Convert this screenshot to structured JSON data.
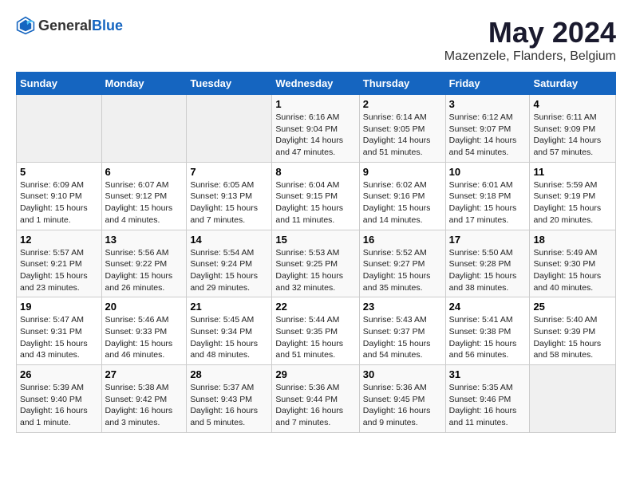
{
  "header": {
    "logo_general": "General",
    "logo_blue": "Blue",
    "month_title": "May 2024",
    "location": "Mazenzele, Flanders, Belgium"
  },
  "days_of_week": [
    "Sunday",
    "Monday",
    "Tuesday",
    "Wednesday",
    "Thursday",
    "Friday",
    "Saturday"
  ],
  "weeks": [
    [
      {
        "day": "",
        "sunrise": "",
        "sunset": "",
        "daylight": "",
        "empty": true
      },
      {
        "day": "",
        "sunrise": "",
        "sunset": "",
        "daylight": "",
        "empty": true
      },
      {
        "day": "",
        "sunrise": "",
        "sunset": "",
        "daylight": "",
        "empty": true
      },
      {
        "day": "1",
        "sunrise": "Sunrise: 6:16 AM",
        "sunset": "Sunset: 9:04 PM",
        "daylight": "Daylight: 14 hours and 47 minutes.",
        "empty": false
      },
      {
        "day": "2",
        "sunrise": "Sunrise: 6:14 AM",
        "sunset": "Sunset: 9:05 PM",
        "daylight": "Daylight: 14 hours and 51 minutes.",
        "empty": false
      },
      {
        "day": "3",
        "sunrise": "Sunrise: 6:12 AM",
        "sunset": "Sunset: 9:07 PM",
        "daylight": "Daylight: 14 hours and 54 minutes.",
        "empty": false
      },
      {
        "day": "4",
        "sunrise": "Sunrise: 6:11 AM",
        "sunset": "Sunset: 9:09 PM",
        "daylight": "Daylight: 14 hours and 57 minutes.",
        "empty": false
      }
    ],
    [
      {
        "day": "5",
        "sunrise": "Sunrise: 6:09 AM",
        "sunset": "Sunset: 9:10 PM",
        "daylight": "Daylight: 15 hours and 1 minute.",
        "empty": false
      },
      {
        "day": "6",
        "sunrise": "Sunrise: 6:07 AM",
        "sunset": "Sunset: 9:12 PM",
        "daylight": "Daylight: 15 hours and 4 minutes.",
        "empty": false
      },
      {
        "day": "7",
        "sunrise": "Sunrise: 6:05 AM",
        "sunset": "Sunset: 9:13 PM",
        "daylight": "Daylight: 15 hours and 7 minutes.",
        "empty": false
      },
      {
        "day": "8",
        "sunrise": "Sunrise: 6:04 AM",
        "sunset": "Sunset: 9:15 PM",
        "daylight": "Daylight: 15 hours and 11 minutes.",
        "empty": false
      },
      {
        "day": "9",
        "sunrise": "Sunrise: 6:02 AM",
        "sunset": "Sunset: 9:16 PM",
        "daylight": "Daylight: 15 hours and 14 minutes.",
        "empty": false
      },
      {
        "day": "10",
        "sunrise": "Sunrise: 6:01 AM",
        "sunset": "Sunset: 9:18 PM",
        "daylight": "Daylight: 15 hours and 17 minutes.",
        "empty": false
      },
      {
        "day": "11",
        "sunrise": "Sunrise: 5:59 AM",
        "sunset": "Sunset: 9:19 PM",
        "daylight": "Daylight: 15 hours and 20 minutes.",
        "empty": false
      }
    ],
    [
      {
        "day": "12",
        "sunrise": "Sunrise: 5:57 AM",
        "sunset": "Sunset: 9:21 PM",
        "daylight": "Daylight: 15 hours and 23 minutes.",
        "empty": false
      },
      {
        "day": "13",
        "sunrise": "Sunrise: 5:56 AM",
        "sunset": "Sunset: 9:22 PM",
        "daylight": "Daylight: 15 hours and 26 minutes.",
        "empty": false
      },
      {
        "day": "14",
        "sunrise": "Sunrise: 5:54 AM",
        "sunset": "Sunset: 9:24 PM",
        "daylight": "Daylight: 15 hours and 29 minutes.",
        "empty": false
      },
      {
        "day": "15",
        "sunrise": "Sunrise: 5:53 AM",
        "sunset": "Sunset: 9:25 PM",
        "daylight": "Daylight: 15 hours and 32 minutes.",
        "empty": false
      },
      {
        "day": "16",
        "sunrise": "Sunrise: 5:52 AM",
        "sunset": "Sunset: 9:27 PM",
        "daylight": "Daylight: 15 hours and 35 minutes.",
        "empty": false
      },
      {
        "day": "17",
        "sunrise": "Sunrise: 5:50 AM",
        "sunset": "Sunset: 9:28 PM",
        "daylight": "Daylight: 15 hours and 38 minutes.",
        "empty": false
      },
      {
        "day": "18",
        "sunrise": "Sunrise: 5:49 AM",
        "sunset": "Sunset: 9:30 PM",
        "daylight": "Daylight: 15 hours and 40 minutes.",
        "empty": false
      }
    ],
    [
      {
        "day": "19",
        "sunrise": "Sunrise: 5:47 AM",
        "sunset": "Sunset: 9:31 PM",
        "daylight": "Daylight: 15 hours and 43 minutes.",
        "empty": false
      },
      {
        "day": "20",
        "sunrise": "Sunrise: 5:46 AM",
        "sunset": "Sunset: 9:33 PM",
        "daylight": "Daylight: 15 hours and 46 minutes.",
        "empty": false
      },
      {
        "day": "21",
        "sunrise": "Sunrise: 5:45 AM",
        "sunset": "Sunset: 9:34 PM",
        "daylight": "Daylight: 15 hours and 48 minutes.",
        "empty": false
      },
      {
        "day": "22",
        "sunrise": "Sunrise: 5:44 AM",
        "sunset": "Sunset: 9:35 PM",
        "daylight": "Daylight: 15 hours and 51 minutes.",
        "empty": false
      },
      {
        "day": "23",
        "sunrise": "Sunrise: 5:43 AM",
        "sunset": "Sunset: 9:37 PM",
        "daylight": "Daylight: 15 hours and 54 minutes.",
        "empty": false
      },
      {
        "day": "24",
        "sunrise": "Sunrise: 5:41 AM",
        "sunset": "Sunset: 9:38 PM",
        "daylight": "Daylight: 15 hours and 56 minutes.",
        "empty": false
      },
      {
        "day": "25",
        "sunrise": "Sunrise: 5:40 AM",
        "sunset": "Sunset: 9:39 PM",
        "daylight": "Daylight: 15 hours and 58 minutes.",
        "empty": false
      }
    ],
    [
      {
        "day": "26",
        "sunrise": "Sunrise: 5:39 AM",
        "sunset": "Sunset: 9:40 PM",
        "daylight": "Daylight: 16 hours and 1 minute.",
        "empty": false
      },
      {
        "day": "27",
        "sunrise": "Sunrise: 5:38 AM",
        "sunset": "Sunset: 9:42 PM",
        "daylight": "Daylight: 16 hours and 3 minutes.",
        "empty": false
      },
      {
        "day": "28",
        "sunrise": "Sunrise: 5:37 AM",
        "sunset": "Sunset: 9:43 PM",
        "daylight": "Daylight: 16 hours and 5 minutes.",
        "empty": false
      },
      {
        "day": "29",
        "sunrise": "Sunrise: 5:36 AM",
        "sunset": "Sunset: 9:44 PM",
        "daylight": "Daylight: 16 hours and 7 minutes.",
        "empty": false
      },
      {
        "day": "30",
        "sunrise": "Sunrise: 5:36 AM",
        "sunset": "Sunset: 9:45 PM",
        "daylight": "Daylight: 16 hours and 9 minutes.",
        "empty": false
      },
      {
        "day": "31",
        "sunrise": "Sunrise: 5:35 AM",
        "sunset": "Sunset: 9:46 PM",
        "daylight": "Daylight: 16 hours and 11 minutes.",
        "empty": false
      },
      {
        "day": "",
        "sunrise": "",
        "sunset": "",
        "daylight": "",
        "empty": true
      }
    ]
  ]
}
